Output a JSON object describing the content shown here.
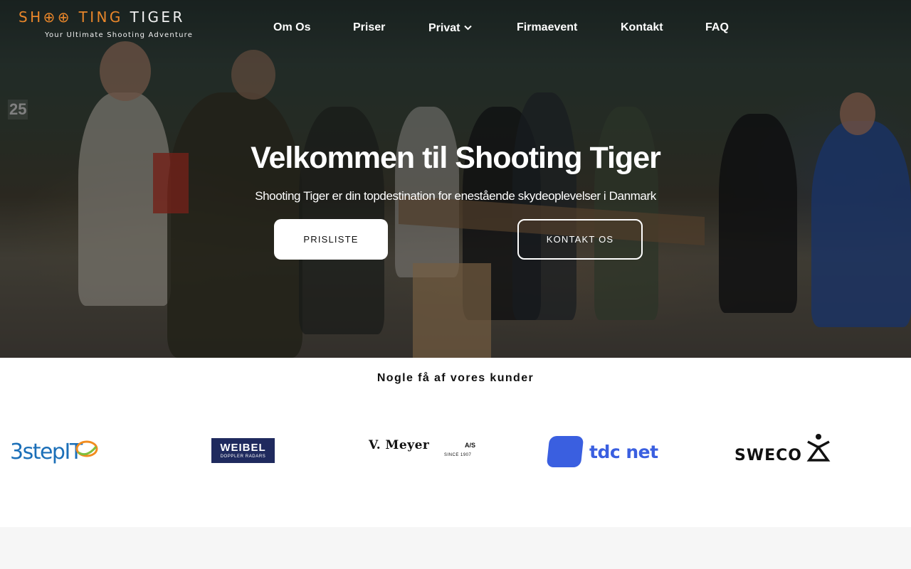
{
  "brand": {
    "name_part1": "SH",
    "name_part2": "TING",
    "name_part3": "TIGER",
    "tagline": "Your Ultimate Shooting Adventure"
  },
  "nav": {
    "items": [
      {
        "label": "Om Os"
      },
      {
        "label": "Priser"
      },
      {
        "label": "Privat",
        "has_dropdown": true
      },
      {
        "label": "Firmaevent"
      },
      {
        "label": "Kontakt"
      },
      {
        "label": "FAQ"
      }
    ]
  },
  "hero": {
    "title": "Velkommen til Shooting Tiger",
    "subtitle": "Shooting Tiger er din topdestination for enestående skydeoplevelser i Danmark",
    "primary_button": "PRISLISTE",
    "secondary_button": "KONTAKT OS",
    "background_sign": "25"
  },
  "clients": {
    "heading": "Nogle få af vores kunder",
    "logos": [
      {
        "name": "3stepIT",
        "text": "3stepIT"
      },
      {
        "name": "Weibel",
        "text": "WEIBEL",
        "subtext": "DOPPLER RADARS"
      },
      {
        "name": "V. Meyer",
        "text": "V. Meyer",
        "suffix": "A/S",
        "subtext": "SINCE 1907"
      },
      {
        "name": "tdc net",
        "text": "tdc net"
      },
      {
        "name": "Sweco",
        "text": "SWECO"
      }
    ]
  },
  "colors": {
    "brand_orange": "#e8862a",
    "tdc_blue": "#3a5fe0",
    "weibel_navy": "#1f2a5e",
    "stepit_blue": "#1b6fb8",
    "stepit_orange": "#f28c1e",
    "stepit_green": "#7fbf3f"
  }
}
